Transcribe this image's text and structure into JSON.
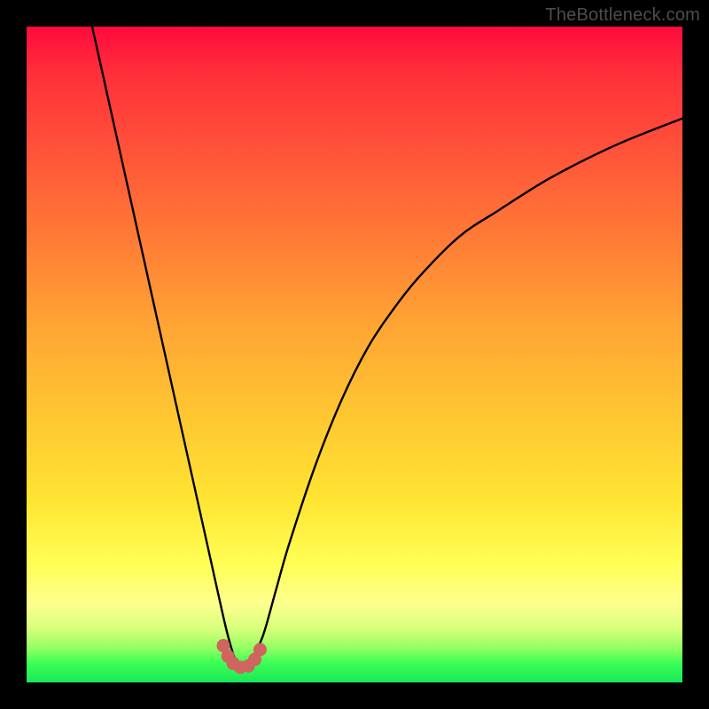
{
  "watermark": "TheBottleneck.com",
  "chart_data": {
    "type": "line",
    "title": "",
    "xlabel": "",
    "ylabel": "",
    "xlim": [
      0,
      100
    ],
    "ylim": [
      0,
      100
    ],
    "series": [
      {
        "name": "bottleneck-curve",
        "x": [
          10,
          12,
          14,
          16,
          18,
          20,
          22,
          24,
          26,
          28,
          30,
          31,
          32,
          33,
          34,
          36,
          38,
          40,
          44,
          48,
          52,
          56,
          60,
          66,
          72,
          80,
          90,
          100
        ],
        "y": [
          100,
          91,
          82,
          73,
          64,
          55,
          46,
          37,
          28,
          19,
          10,
          6,
          3,
          2,
          3,
          7,
          14,
          21,
          33,
          43,
          51,
          57,
          62,
          68,
          72,
          77,
          82,
          86
        ]
      }
    ],
    "markers": {
      "name": "bottom-u-markers",
      "color": "#d0645f",
      "points": [
        {
          "x": 30.0,
          "y": 5.6
        },
        {
          "x": 30.7,
          "y": 4.0
        },
        {
          "x": 31.5,
          "y": 2.9
        },
        {
          "x": 32.6,
          "y": 2.3
        },
        {
          "x": 33.8,
          "y": 2.5
        },
        {
          "x": 34.8,
          "y": 3.5
        },
        {
          "x": 35.6,
          "y": 5.0
        }
      ]
    },
    "gradient_stops": [
      {
        "pos": 0,
        "color": "#ff0a3c"
      },
      {
        "pos": 7,
        "color": "#ff2f3a"
      },
      {
        "pos": 18,
        "color": "#ff503a"
      },
      {
        "pos": 30,
        "color": "#ff7436"
      },
      {
        "pos": 45,
        "color": "#ffa334"
      },
      {
        "pos": 60,
        "color": "#ffc832"
      },
      {
        "pos": 72,
        "color": "#ffe432"
      },
      {
        "pos": 82,
        "color": "#ffff55"
      },
      {
        "pos": 88,
        "color": "#fdff8e"
      },
      {
        "pos": 92,
        "color": "#d4ff7a"
      },
      {
        "pos": 95,
        "color": "#8cff60"
      },
      {
        "pos": 97,
        "color": "#3dff55"
      },
      {
        "pos": 100,
        "color": "#17e85a"
      }
    ]
  }
}
